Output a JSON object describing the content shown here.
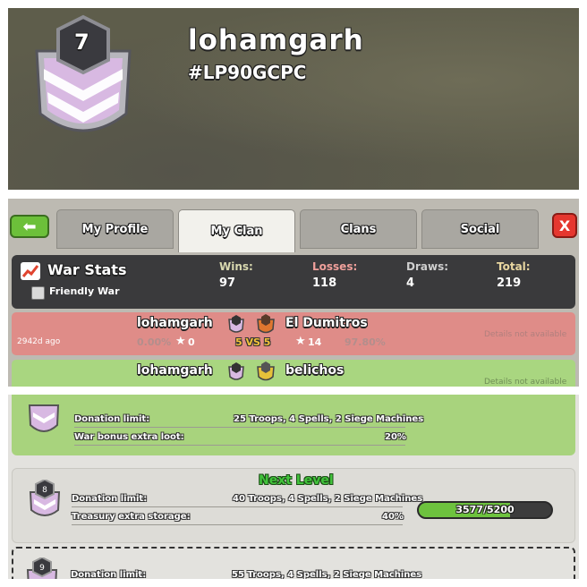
{
  "profile_header": {
    "clan_name": "lohamgarh",
    "clan_tag": "#LP90GCPC",
    "clan_level": "7"
  },
  "tabs": [
    {
      "label": "My Profile"
    },
    {
      "label": "My Clan"
    },
    {
      "label": "Clans"
    },
    {
      "label": "Social"
    }
  ],
  "close_label": "X",
  "war_stats": {
    "title": "War Stats",
    "friendly_war_label": "Friendly War",
    "wins_label": "Wins:",
    "wins": "97",
    "losses_label": "Losses:",
    "losses": "118",
    "draws_label": "Draws:",
    "draws": "4",
    "total_label": "Total:",
    "total": "219"
  },
  "wars": [
    {
      "clan": "lohamgarh",
      "clan_level": "7",
      "opponent": "El Dumitros",
      "opponent_level": "8",
      "ago": "2942d ago",
      "pct_left": "0.00%",
      "stars_left": "0",
      "vs": "5 VS 5",
      "stars_right": "14",
      "pct_right": "97.80%",
      "details": "Details not available",
      "result": "loss"
    },
    {
      "clan": "lohamgarh",
      "clan_level": "7",
      "opponent": "belichos",
      "opponent_level": "9",
      "details": "Details not available",
      "result": "win"
    }
  ],
  "levels": [
    {
      "level": "7",
      "donation_label": "Donation limit:",
      "donation_value": "25 Troops, 4 Spells, 2 Siege Machines",
      "bonus_label": "War bonus extra loot:",
      "bonus_value": "20%"
    },
    {
      "level": "8",
      "heading": "Next Level",
      "donation_label": "Donation limit:",
      "donation_value": "40 Troops, 4 Spells, 2 Siege Machines",
      "bonus_label": "Treasury extra storage:",
      "bonus_value": "40%",
      "progress_text": "3577/5200",
      "progress_fraction": 0.688
    },
    {
      "level": "9",
      "donation_label": "Donation limit:",
      "donation_value": "55 Troops, 4 Spells, 2 Siege Machines"
    }
  ],
  "colors": {
    "badge_purple": "#d9b6e3",
    "badge_frame": "#a6a6ad",
    "win_green": "#a9d680",
    "loss_red": "#df8c88",
    "progress_green": "#6dc23e"
  }
}
